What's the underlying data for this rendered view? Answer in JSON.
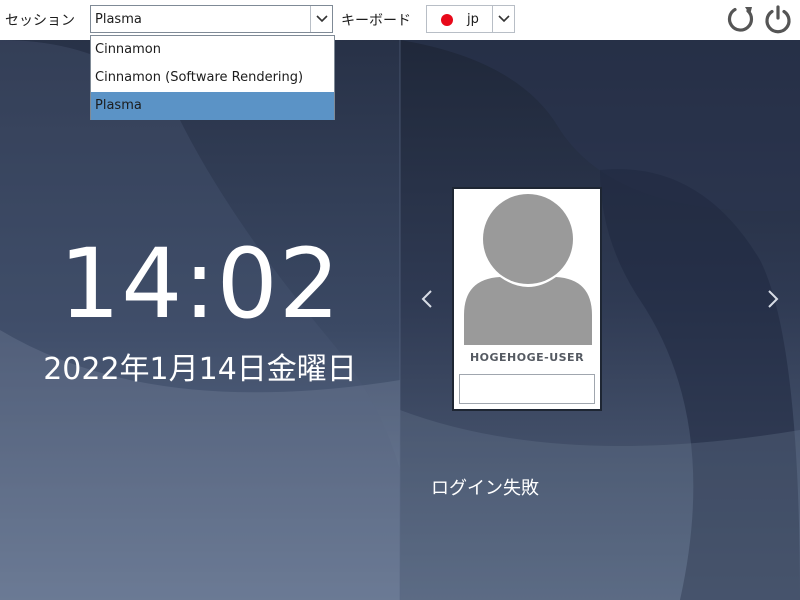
{
  "topbar": {
    "session_label": "セッション",
    "session_value": "Plasma",
    "keyboard_label": "キーボード",
    "keyboard_value": "jp",
    "restart_icon": "restart-icon",
    "shutdown_icon": "power-icon"
  },
  "session_dropdown": {
    "options": [
      "Cinnamon",
      "Cinnamon (Software Rendering)",
      "Plasma"
    ],
    "selected": "Plasma"
  },
  "clock": {
    "time": "14:02",
    "date": "2022年1月14日金曜日"
  },
  "user": {
    "name": "HOGEHOGE-USER",
    "password": ""
  },
  "status": {
    "message": "ログイン失敗"
  },
  "colors": {
    "selection": "#5b93c6",
    "flag": "#e8091a",
    "background": "#2f3b55"
  }
}
